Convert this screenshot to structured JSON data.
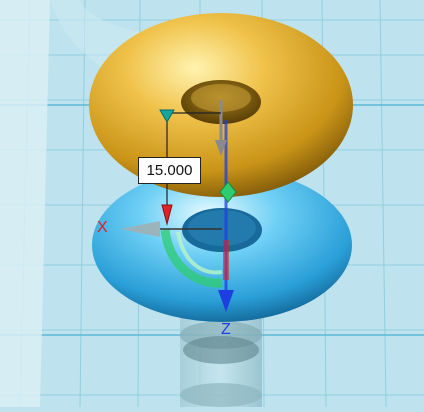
{
  "dimension": {
    "value": "15.000"
  },
  "axes": {
    "x": {
      "label": "X",
      "color": "#e0202a"
    },
    "z": {
      "label": "Z",
      "color": "#1e3fe0"
    }
  },
  "objects": [
    {
      "name": "upper-torus",
      "color": "#e8b53a"
    },
    {
      "name": "lower-torus",
      "color": "#53bff0"
    }
  ],
  "colors": {
    "background": "#bfe3ee",
    "grid": "#8fcfe0",
    "gizmo_green": "#2ecc71"
  }
}
